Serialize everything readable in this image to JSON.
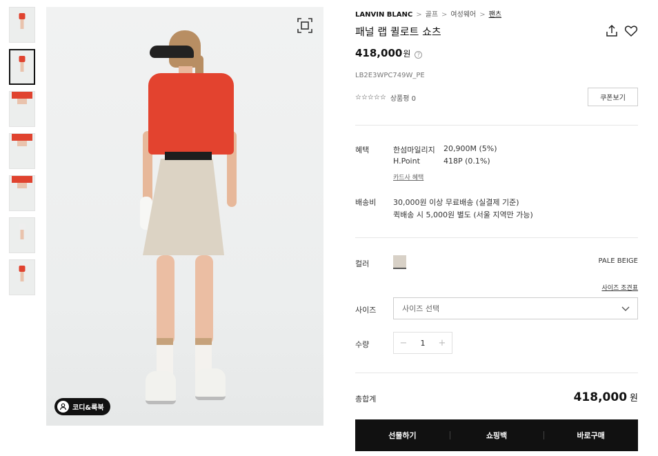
{
  "breadcrumb": {
    "brand": "LANVIN BLANC",
    "sep": ">",
    "items": [
      "골프",
      "여성웨어",
      "팬츠"
    ]
  },
  "product": {
    "title": "패널 랩 퀼로트 쇼츠",
    "price": "418,000",
    "currency": "원",
    "price_info_icon": "?",
    "sku": "LB2E3WPC749W_PE",
    "rating_stars": "☆☆☆☆☆",
    "rating_stars_count": 0,
    "review_label": "상품평 0",
    "coupon_button": "쿠폰보기"
  },
  "benefits": {
    "label": "혜택",
    "rows": [
      {
        "name": "한섬마일리지",
        "value": "20,900M (5%)"
      },
      {
        "name": "H.Point",
        "value": "418P (0.1%)"
      }
    ],
    "card_link": "카드사 혜택"
  },
  "shipping": {
    "label": "배송비",
    "line1": "30,000원 이상 무료배송 (실결제 기준)",
    "line2": "퀵배송 시 5,000원 별도 (서울 지역만 가능)"
  },
  "color": {
    "label": "컬러",
    "swatch": "#d8d1c7",
    "name": "PALE BEIGE"
  },
  "size": {
    "guide_link": "사이즈 조견표",
    "label": "사이즈",
    "placeholder": "사이즈 선택"
  },
  "quantity": {
    "label": "수량",
    "minus": "−",
    "value": "1",
    "plus": "+"
  },
  "total": {
    "label": "총합계",
    "price": "418,000",
    "currency": "원"
  },
  "actions": {
    "gift": "선물하기",
    "cart": "쇼핑백",
    "buy": "바로구매"
  },
  "gallery": {
    "codi_button": "코디&룩북",
    "thumb_count": 7,
    "active_thumb": 2
  },
  "colors": {
    "accent": "#111111",
    "shirt": "#e3432f",
    "skirt": "#dcd3c4"
  }
}
